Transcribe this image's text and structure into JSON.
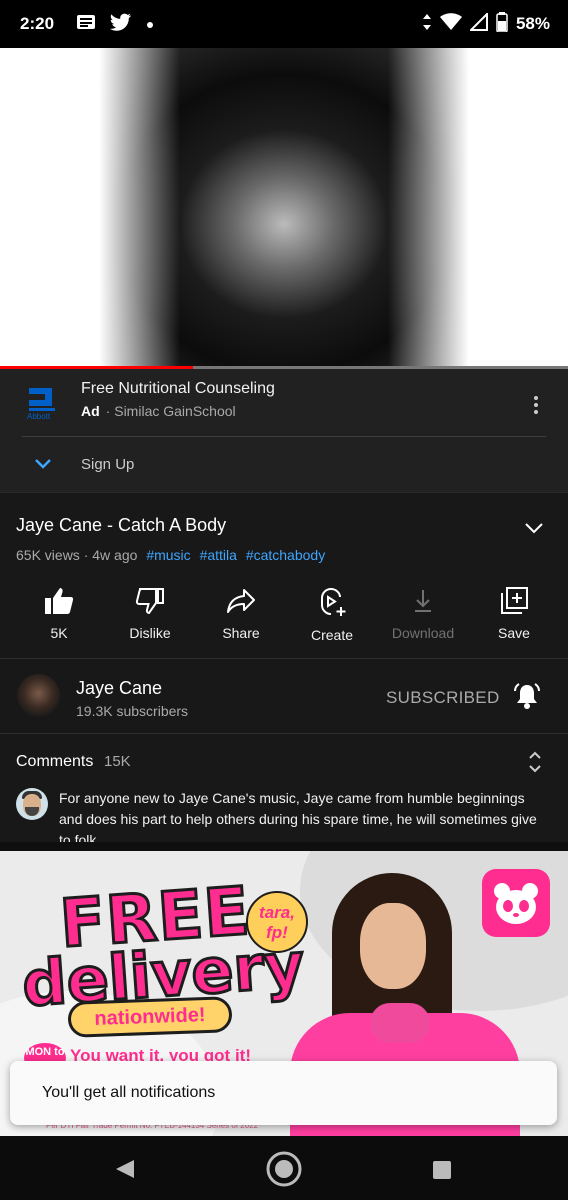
{
  "status_bar": {
    "time": "2:20",
    "battery": "58%",
    "icons": [
      "news-icon",
      "twitter-icon",
      "dot-icon",
      "data-arrows-icon",
      "wifi-icon",
      "signal-icon",
      "battery-icon"
    ]
  },
  "player": {
    "progress_fraction": 0.34
  },
  "ad": {
    "logo_text": "Abbott",
    "title": "Free Nutritional Counseling",
    "badge": "Ad",
    "separator": "·",
    "advertiser": "Similac GainSchool",
    "cta": "Sign Up"
  },
  "video": {
    "title": "Jaye Cane - Catch A Body",
    "views": "65K views",
    "separator": "·",
    "age": "4w ago",
    "hashtags": [
      "#music",
      "#attila",
      "#catchabody"
    ]
  },
  "actions": [
    {
      "label": "5K",
      "icon": "thumbs-up-icon"
    },
    {
      "label": "Dislike",
      "icon": "thumbs-down-icon"
    },
    {
      "label": "Share",
      "icon": "share-icon"
    },
    {
      "label": "Create",
      "icon": "create-icon"
    },
    {
      "label": "Download",
      "icon": "download-icon"
    },
    {
      "label": "Save",
      "icon": "save-icon"
    }
  ],
  "channel": {
    "name": "Jaye Cane",
    "subscribers": "19.3K subscribers",
    "subscribe_state": "SUBSCRIBED"
  },
  "comments": {
    "header": "Comments",
    "count": "15K",
    "top_comment": "For anyone new to Jaye Cane's music, Jaye came from humble beginnings and does his part to help others during his spare time, he will sometimes give to folk..."
  },
  "banner": {
    "line1": "FREE",
    "line2": "delivery",
    "pill": "nationwide!",
    "sticker": "tara, fp!",
    "day_badge": "MON to",
    "tagline": "You want it, you got it!",
    "permit": "Per DTI Fair Trade Permit No. FTEB-144134 Series of 2022",
    "brand": "foodpanda",
    "brand_color": "#ff2d8f"
  },
  "toast": {
    "message": "You'll get all notifications"
  },
  "colors": {
    "background": "#181818",
    "accent_link": "#3ea6ff",
    "progress": "#ff0000"
  }
}
